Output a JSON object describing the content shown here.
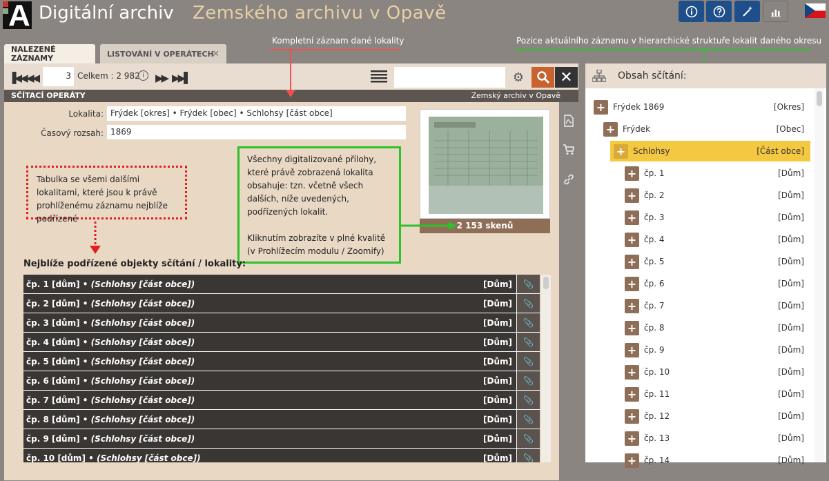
{
  "header": {
    "logo_letter": "A",
    "title_part1": "Digitální archiv",
    "title_part2": "Zemského archivu v Opavě",
    "buttons": [
      "info-icon",
      "help-icon",
      "magic-wand-icon",
      "chart-icon"
    ]
  },
  "tabs": [
    {
      "label": "NALEZENÉ ZÁZNAMY",
      "active": true
    },
    {
      "label": "LISTOVÁNÍ V OPERÁTECH",
      "active": false
    }
  ],
  "toolbar": {
    "page_value": "3",
    "total_label": "Celkem : 2 982",
    "search_value": ""
  },
  "section": {
    "left": "SČÍTACÍ OPERÁTY",
    "right": "Zemský archiv v Opavě"
  },
  "record": {
    "locality_label": "Lokalita:",
    "locality_value": "Frýdek [okres] • Frýdek [obec] • Schlohsy [část obce]",
    "range_label": "Časový rozsah:",
    "range_value": "1869",
    "scans": "2 153 skenů"
  },
  "annotations": {
    "top_center": "Kompletní záznam dané lokality",
    "top_right": "Pozice aktuálního záznamu v hierarchické struktuře lokalit daného okresu",
    "red_note": "Tabulka se všemi dalšími lokalitami, které jsou k právě prohlíženému záznamu nejblíže podřízené",
    "green_note_1": "Všechny digitalizované přílohy, které právě zobrazená lokalita obsahuje: tzn. včetně všech dalších, níže uvedených, podřízených lokalit.",
    "green_note_2": "Kliknutím zobrazíte v plné kvalitě (v Prohlížecím modulu / Zoomify)"
  },
  "table": {
    "heading": "Nejblíže podřízené objekty sčítání / lokality:",
    "rows": [
      {
        "main": "čp. 1 [dům] • ",
        "italic": "(Schlohsy [část obce])",
        "type": "[Dům]"
      },
      {
        "main": "čp. 2 [dům] • ",
        "italic": "(Schlohsy [část obce])",
        "type": "[Dům]"
      },
      {
        "main": "čp. 3 [dům] • ",
        "italic": "(Schlohsy [část obce])",
        "type": "[Dům]"
      },
      {
        "main": "čp. 4 [dům] • ",
        "italic": "(Schlohsy [část obce])",
        "type": "[Dům]"
      },
      {
        "main": "čp. 5 [dům] • ",
        "italic": "(Schlohsy [část obce])",
        "type": "[Dům]"
      },
      {
        "main": "čp. 6 [dům] • ",
        "italic": "(Schlohsy [část obce])",
        "type": "[Dům]"
      },
      {
        "main": "čp. 7 [dům] • ",
        "italic": "(Schlohsy [část obce])",
        "type": "[Dům]"
      },
      {
        "main": "čp. 8 [dům] • ",
        "italic": "(Schlohsy [část obce])",
        "type": "[Dům]"
      },
      {
        "main": "čp. 9 [dům] • ",
        "italic": "(Schlohsy [část obce])",
        "type": "[Dům]"
      },
      {
        "main": "čp. 10 [dům] • ",
        "italic": "(Schlohsy [část obce])",
        "type": "[Dům]"
      }
    ]
  },
  "tree": {
    "title": "Obsah sčítání:",
    "nodes": [
      {
        "name": "Frýdek 1869",
        "type": "[Okres]"
      },
      {
        "name": "Frýdek",
        "type": "[Obec]"
      },
      {
        "name": "Schlohsy",
        "type": "[Část obce]"
      },
      {
        "name": "čp. 1",
        "type": "[Dům]"
      },
      {
        "name": "čp. 2",
        "type": "[Dům]"
      },
      {
        "name": "čp. 3",
        "type": "[Dům]"
      },
      {
        "name": "čp. 4",
        "type": "[Dům]"
      },
      {
        "name": "čp. 5",
        "type": "[Dům]"
      },
      {
        "name": "čp. 6",
        "type": "[Dům]"
      },
      {
        "name": "čp. 7",
        "type": "[Dům]"
      },
      {
        "name": "čp. 8",
        "type": "[Dům]"
      },
      {
        "name": "čp. 9",
        "type": "[Dům]"
      },
      {
        "name": "čp. 10",
        "type": "[Dům]"
      },
      {
        "name": "čp. 11",
        "type": "[Dům]"
      },
      {
        "name": "čp. 12",
        "type": "[Dům]"
      },
      {
        "name": "čp. 13",
        "type": "[Dům]"
      },
      {
        "name": "čp. 14",
        "type": "[Dům]"
      }
    ]
  },
  "colors": {
    "accent": "#c8622e",
    "header_button": "#1f4f8a",
    "selected": "#f5c842",
    "brown": "#8e6e56"
  }
}
